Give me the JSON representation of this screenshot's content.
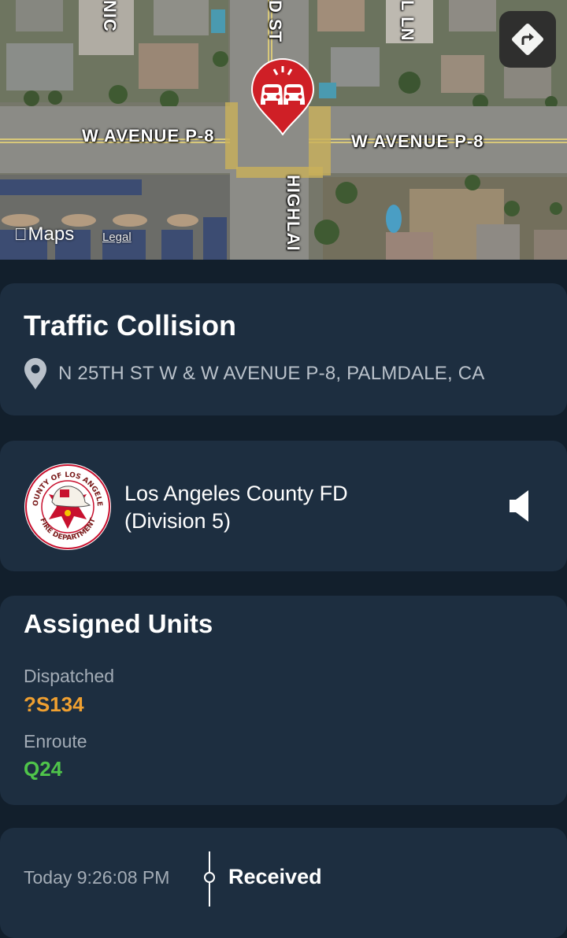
{
  "map": {
    "streets": {
      "avenue_left": "W AVENUE P-8",
      "avenue_right": "W AVENUE P-8",
      "street_top_left": "NIC",
      "street_top_mid": "D ST",
      "street_top_right": "L LN",
      "street_bottom": "HIGHLAI"
    },
    "brand": "Maps",
    "legal": "Legal",
    "incident_icon": "car-collision-pin-icon",
    "directions_icon": "directions-icon"
  },
  "incident": {
    "title": "Traffic Collision",
    "address": "N 25TH ST W & W AVENUE P-8, PALMDALE, CA",
    "location_icon": "location-pin-icon"
  },
  "agency": {
    "name_line1": "Los Angeles County FD",
    "name_line2": "(Division 5)",
    "logo_text_top": "COUNTY OF LOS ANGELES",
    "logo_text_bottom": "FIRE DEPARTMENT",
    "audio_icon": "speaker-icon"
  },
  "units": {
    "title": "Assigned Units",
    "groups": [
      {
        "status": "Dispatched",
        "unit": "?S134",
        "color": "#f0a030"
      },
      {
        "status": "Enroute",
        "unit": "Q24",
        "color": "#4fc44a"
      }
    ]
  },
  "timeline": {
    "time": "Today 9:26:08 PM",
    "event": "Received"
  },
  "colors": {
    "background": "#121f2c",
    "card": "#1d2e40",
    "pin": "#cf1f26"
  }
}
